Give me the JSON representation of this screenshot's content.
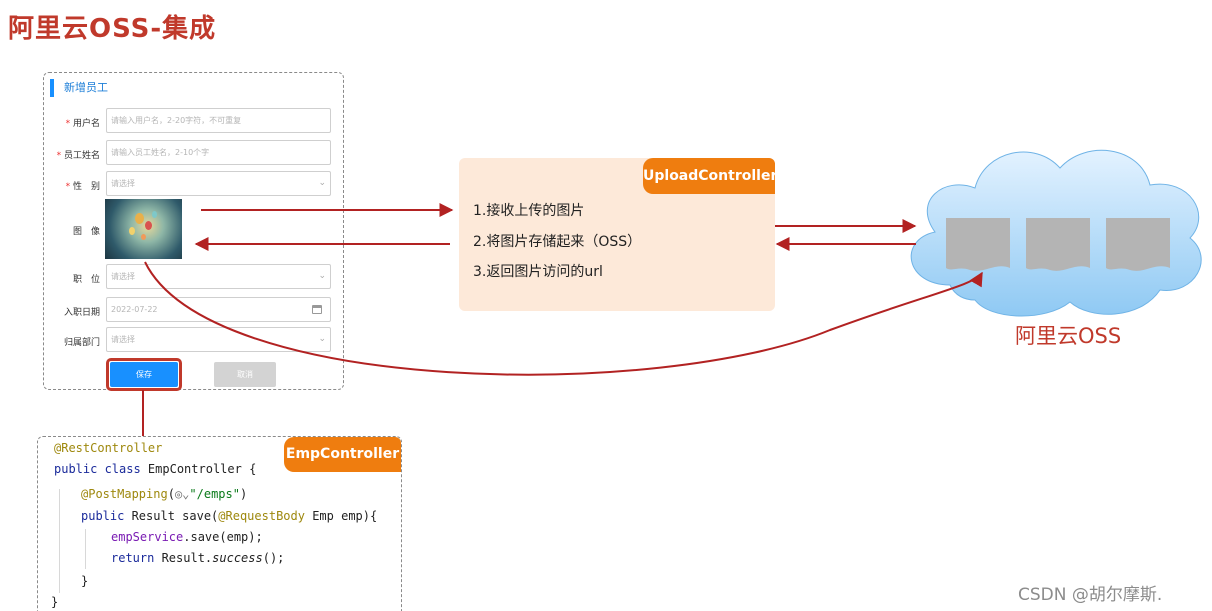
{
  "page_title": "阿里云OSS-集成",
  "form": {
    "header": "新增员工",
    "fields": [
      {
        "label": "用户名",
        "required": true,
        "placeholder": "请输入用户名，2-20字符，不可重复"
      },
      {
        "label": "员工姓名",
        "required": true,
        "placeholder": "请输入员工姓名，2-10个字"
      },
      {
        "label": "性　别",
        "required": true,
        "placeholder": "请选择"
      },
      {
        "label": "图　像",
        "required": false
      },
      {
        "label": "职　位",
        "required": false,
        "placeholder": "请选择"
      },
      {
        "label": "入职日期",
        "required": false,
        "value": "2022-07-22"
      },
      {
        "label": "归属部门",
        "required": false,
        "placeholder": "请选择"
      }
    ],
    "save_label": "保存",
    "cancel_label": "取消"
  },
  "upload_controller": {
    "title": "UploadController",
    "steps": [
      "1.接收上传的图片",
      "2.将图片存储起来（OSS）",
      "3.返回图片访问的url"
    ]
  },
  "oss": {
    "label": "阿里云OSS"
  },
  "emp_controller": {
    "title": "EmpController",
    "code": {
      "l1": "@RestController",
      "l2_kw": "public class",
      "l2_rest": " EmpController {",
      "l3_ann": "@PostMapping",
      "l3_rest": "(",
      "l3_str": "\"/emps\"",
      "l3_end": ")",
      "l4_kw": "public",
      "l4_a": " Result save(",
      "l4_ann": "@RequestBody",
      "l4_b": " Emp emp){",
      "l5_fld": "empService",
      "l5_rest": ".save(emp);",
      "l6_kw": "return",
      "l6_a": " Result.",
      "l6_it": "success",
      "l6_b": "();",
      "l7": "}",
      "l8": "}"
    }
  },
  "watermark": "CSDN @胡尔摩斯."
}
